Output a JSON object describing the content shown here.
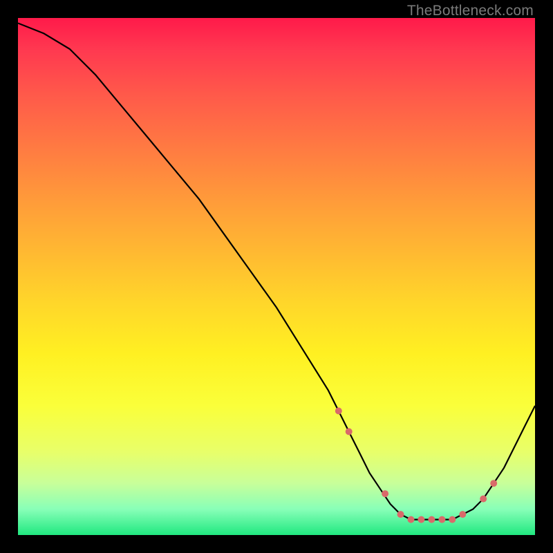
{
  "attribution": "TheBottleneck.com",
  "chart_data": {
    "type": "line",
    "title": "",
    "xlabel": "",
    "ylabel": "",
    "xlim": [
      0,
      100
    ],
    "ylim": [
      0,
      100
    ],
    "background_gradient": {
      "top_color": "#ff1a4a",
      "bottom_color": "#20e880",
      "description": "Red (high bottleneck) to green (optimal) vertical gradient"
    },
    "series": [
      {
        "name": "bottleneck-curve",
        "color": "#000000",
        "x": [
          0,
          5,
          10,
          15,
          20,
          25,
          30,
          35,
          40,
          45,
          50,
          55,
          60,
          62,
          64,
          66,
          68,
          70,
          72,
          74,
          76,
          78,
          80,
          82,
          84,
          86,
          88,
          90,
          92,
          94,
          96,
          98,
          100
        ],
        "y": [
          99,
          97,
          94,
          89,
          83,
          77,
          71,
          65,
          58,
          51,
          44,
          36,
          28,
          24,
          20,
          16,
          12,
          9,
          6,
          4,
          3,
          3,
          3,
          3,
          3,
          4,
          5,
          7,
          10,
          13,
          17,
          21,
          25
        ]
      }
    ],
    "highlight": {
      "name": "optimal-zone-markers",
      "color": "#d96a6a",
      "marker_radius": 5,
      "points_x": [
        62,
        64,
        71,
        74,
        76,
        78,
        80,
        82,
        84,
        86,
        90,
        92
      ],
      "points_y": [
        24,
        20,
        8,
        4,
        3,
        3,
        3,
        3,
        3,
        4,
        7,
        10
      ]
    }
  }
}
